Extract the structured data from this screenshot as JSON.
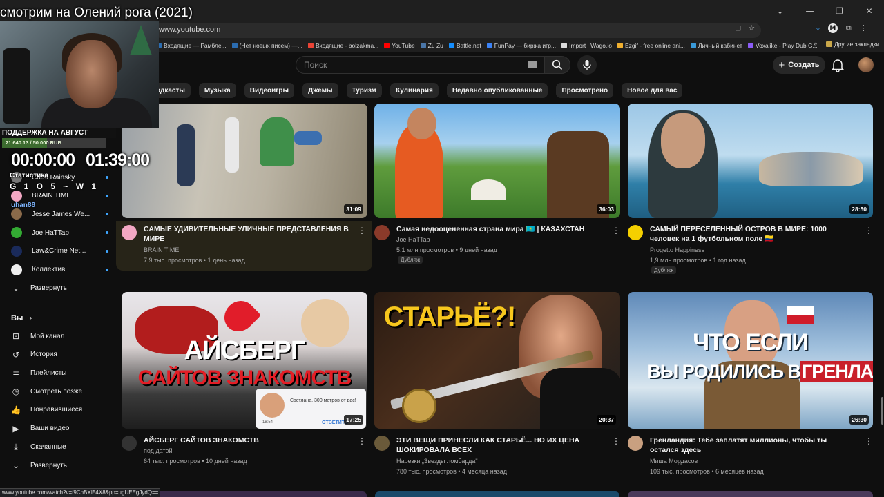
{
  "stream": {
    "title": "смотрим на Олений рога (2021)",
    "donation_title": "ПОДДЕРЖКА НА АВГУСТ",
    "donation_text": "21 640.13 / 50 000 RUB",
    "donation_progress": 0.433,
    "timer_elapsed": "00:00:00",
    "timer_total": "01:39:00",
    "stats_label": "Статистика",
    "stats_glyphs": "G 1 O 5 ~ W 1",
    "stats_user": "uhan88"
  },
  "browser": {
    "url": "www.youtube.com",
    "status_url": "www.youtube.com/watch?v=f9ChBXI54X8&pp=ugUEEgJydQ==",
    "bookmarks": [
      {
        "label": "Входящие — Рамбле...",
        "color": "#2b6cb0"
      },
      {
        "label": "(Нет новых писем) —...",
        "color": "#2b6cb0"
      },
      {
        "label": "Входящие - bolzakma...",
        "color": "#ea4335"
      },
      {
        "label": "YouTube",
        "color": "#ff0000"
      },
      {
        "label": "Zu Zu",
        "color": "#4a76a8"
      },
      {
        "label": "Battle.net",
        "color": "#148eff"
      },
      {
        "label": "FunPay — биржа игр...",
        "color": "#3b82f6"
      },
      {
        "label": "Import | Wago.io",
        "color": "#dddddd"
      },
      {
        "label": "Ezgif - free online ani...",
        "color": "#f0b030"
      },
      {
        "label": "Личный кабинет",
        "color": "#3a9ad9"
      },
      {
        "label": "Voxalike - Play Dub G...",
        "color": "#8b5cf6"
      }
    ],
    "bookmarks_more": "»",
    "other_bookmarks": "Другие закладки"
  },
  "header": {
    "search_placeholder": "Поиск",
    "create_label": "Создать"
  },
  "chips": [
    "одкасты",
    "Музыка",
    "Видеоигры",
    "Джемы",
    "Туризм",
    "Кулинария",
    "Недавно опубликованные",
    "Просмотрено",
    "Новое для вас"
  ],
  "sidebar": {
    "subscriptions": [
      {
        "label": "Crest Rainsky",
        "color": "#777777",
        "dot": true
      },
      {
        "label": "BRAIN TIME",
        "color": "#f2a7c3",
        "dot": true
      },
      {
        "label": "Jesse James We...",
        "color": "#8a6a4a",
        "dot": true
      },
      {
        "label": "Joe HaTTab",
        "color": "#33aa33",
        "dot": true
      },
      {
        "label": "Law&Crime Net...",
        "color": "#1a2a5a",
        "dot": true
      },
      {
        "label": "Коллектив",
        "color": "#eeeeee",
        "dot": true
      }
    ],
    "expand_label": "Развернуть",
    "you_label": "Вы",
    "you_items": [
      {
        "label": "Мой канал",
        "icon": "⊡"
      },
      {
        "label": "История",
        "icon": "↺"
      },
      {
        "label": "Плейлисты",
        "icon": "≡"
      },
      {
        "label": "Смотреть позже",
        "icon": "◷"
      },
      {
        "label": "Понравившиеся",
        "icon": "👍"
      },
      {
        "label": "Ваши видео",
        "icon": "▶"
      },
      {
        "label": "Скачанные",
        "icon": "⤓"
      }
    ],
    "expand_label_2": "Развернуть"
  },
  "videos": [
    {
      "title": "САМЫЕ УДИВИТЕЛЬНЫЕ УЛИЧНЫЕ ПРЕДСТАВЛЕНИЯ В МИРЕ",
      "channel": "BRAIN TIME",
      "meta": "7,9 тыс. просмотров • 1 день назад",
      "duration": "31:09",
      "dub": "",
      "avatar_color": "#f2a7c3"
    },
    {
      "title": "Самая недооцененная страна мира 🇰🇿 | КАЗАХСТАН",
      "channel": "Joe HaTTab",
      "meta": "5,1 млн просмотров • 9 дней назад",
      "duration": "36:03",
      "dub": "Дубляж",
      "avatar_color": "#8a3a2a"
    },
    {
      "title": "САМЫЙ ПЕРЕСЕЛЕННЫЙ ОСТРОВ В МИРЕ: 1000 человек на 1 футбольном поле 🇨🇴",
      "channel": "Progetto Happiness",
      "meta": "1,9 млн просмотров • 1 год назад",
      "duration": "28:50",
      "dub": "Дубляж",
      "avatar_color": "#f5d000"
    },
    {
      "title": "АЙСБЕРГ САЙТОВ ЗНАКОМСТВ",
      "channel": "под датой",
      "meta": "64 тыс. просмотров • 10 дней назад",
      "duration": "17:25",
      "dub": "",
      "avatar_color": "#333333"
    },
    {
      "title": "ЭТИ ВЕЩИ ПРИНЕСЛИ КАК СТАРЬЁ... НО ИХ ЦЕНА ШОКИРОВАЛА ВСЕХ",
      "channel": "Нарезки „Звезды ломбарда\"",
      "meta": "780 тыс. просмотров • 4 месяца назад",
      "duration": "20:37",
      "dub": "",
      "avatar_color": "#6a5a3a"
    },
    {
      "title": "Гренландия: Тебе заплатят миллионы, чтобы ты остался здесь",
      "channel": "Миша Мордасов",
      "meta": "109 тыс. просмотров • 6 месяцев назад",
      "duration": "26:30",
      "dub": "",
      "avatar_color": "#c9a080"
    }
  ],
  "thumb_text": {
    "iceberg_line1": "АЙСБЕРГ",
    "iceberg_line2": "САЙТОВ ЗНАКОМСТВ",
    "iceberg_chat": "Светлана, 300 метров от вас!",
    "iceberg_reply": "ОТВЕТИТЬ",
    "iceberg_time": "18:54",
    "pawn": "СТАРЬЁ?!",
    "greenland_line1": "ЧТО ЕСЛИ",
    "greenland_line2": "ВЫ РОДИЛИСЬ В",
    "greenland_line3": "ГРЕНЛАНДИИ"
  }
}
